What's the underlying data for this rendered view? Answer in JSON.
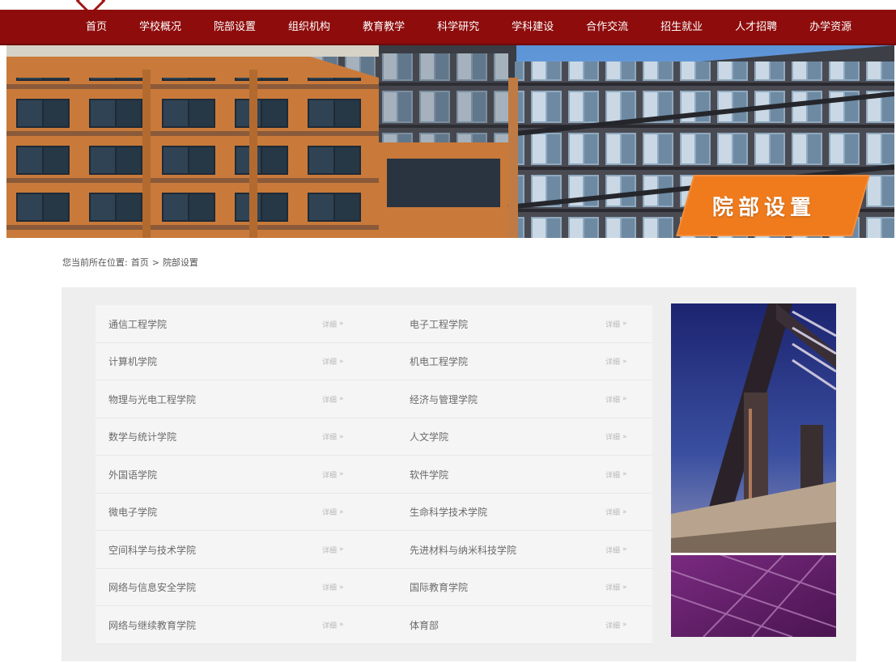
{
  "nav": {
    "items": [
      "首页",
      "学校概况",
      "院部设置",
      "组织机构",
      "教育教学",
      "科学研究",
      "学科建设",
      "合作交流",
      "招生就业",
      "人才招聘",
      "办学资源"
    ],
    "active_index": 2
  },
  "banner": {
    "title": "院部设置"
  },
  "breadcrumb": {
    "prefix": "您当前所在位置:",
    "home": "首页",
    "separator": ">",
    "current": "院部设置"
  },
  "departments": {
    "detail_label": "详细",
    "detail_icon": "arrow-right-icon",
    "left": [
      "通信工程学院",
      "计算机学院",
      "物理与光电工程学院",
      "数学与统计学院",
      "外国语学院",
      "微电子学院",
      "空间科学与技术学院",
      "网络与信息安全学院",
      "网络与继续教育学院"
    ],
    "right": [
      "电子工程学院",
      "机电工程学院",
      "经济与管理学院",
      "人文学院",
      "软件学院",
      "生命科学技术学院",
      "先进材料与纳米科技学院",
      "国际教育学院",
      "体育部"
    ]
  },
  "colors": {
    "nav_bg": "#8e0c0c",
    "badge": "#f07b1c",
    "panel_bg": "#eeeeee"
  }
}
